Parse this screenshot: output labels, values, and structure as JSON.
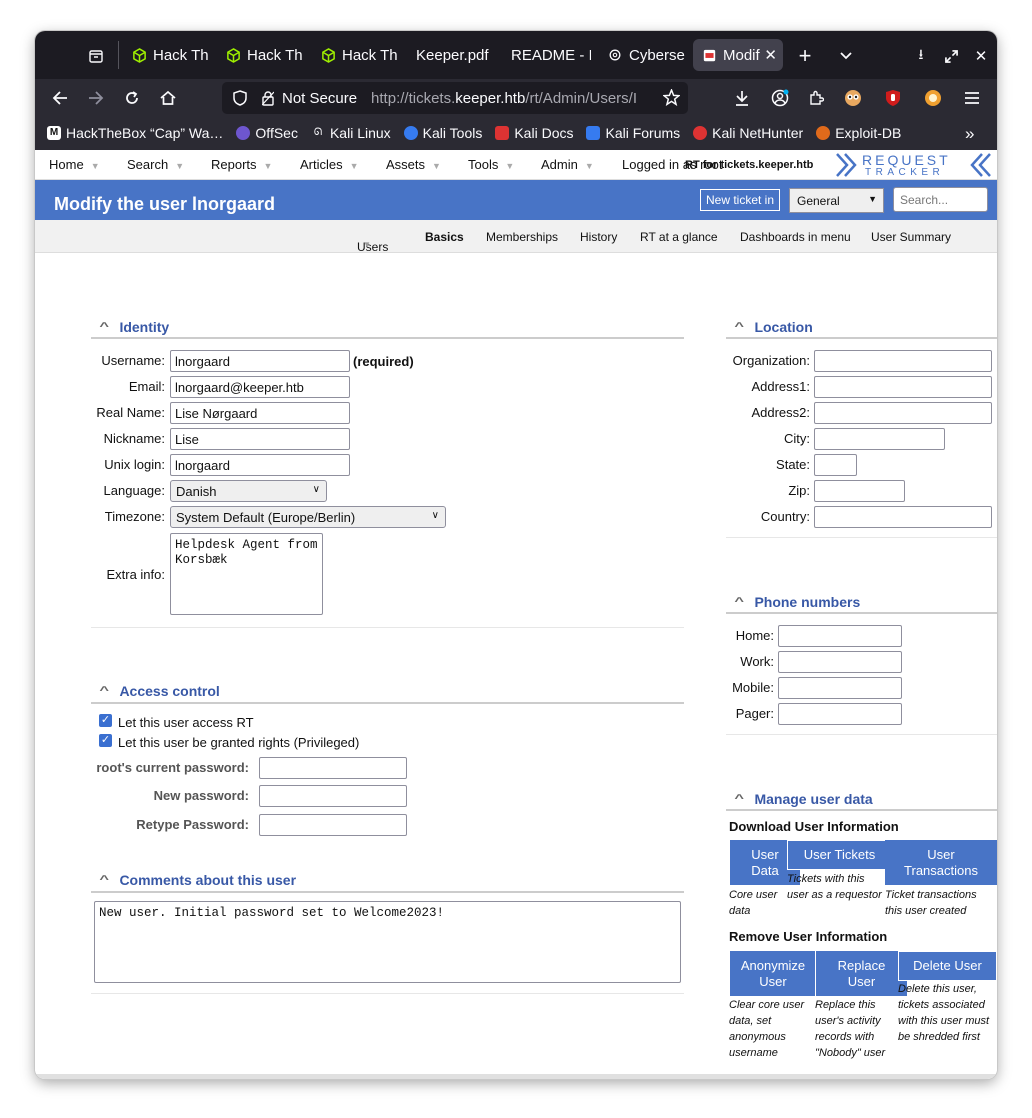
{
  "browser": {
    "tabs": [
      {
        "label": "Hack Th",
        "icon": "htb-cube-icon"
      },
      {
        "label": "Hack Th",
        "icon": "htb-cube-icon"
      },
      {
        "label": "Hack Th",
        "icon": "htb-cube-icon"
      },
      {
        "label": "Keeper.pdf",
        "icon": ""
      },
      {
        "label": "README - I",
        "icon": ""
      },
      {
        "label": "Cyberse",
        "icon": "openai-icon"
      },
      {
        "label": "Modif",
        "icon": "rt-favicon"
      }
    ],
    "url": {
      "security": "Not Secure",
      "prefix": "http://tickets.",
      "domain": "keeper.htb",
      "path": "/rt/Admin/Users/I"
    },
    "bookmarks": [
      {
        "label": "HackTheBox “Cap” Wa…",
        "color": "#111111"
      },
      {
        "label": "OffSec",
        "color": "#6e56cf"
      },
      {
        "label": "Kali Linux",
        "color": "#2b2a33"
      },
      {
        "label": "Kali Tools",
        "color": "#367bf0"
      },
      {
        "label": "Kali Docs",
        "color": "#d33"
      },
      {
        "label": "Kali Forums",
        "color": "#367bf0"
      },
      {
        "label": "Kali NetHunter",
        "color": "#d33"
      },
      {
        "label": "Exploit-DB",
        "color": "#e06a1b"
      }
    ]
  },
  "rt": {
    "menu": [
      "Home",
      "Search",
      "Reports",
      "Articles",
      "Assets",
      "Tools",
      "Admin"
    ],
    "logged_in": "Logged in as",
    "logged_user": "root",
    "rt_for": "RT for tickets.keeper.htb",
    "logo_top": "REQUEST",
    "logo_bottom": "TRACKER",
    "title": "Modify the user lnorgaard",
    "new_ticket_btn": "New ticket in",
    "queue_value": "General",
    "search_placeholder": "Search...",
    "subnav": [
      "Users",
      "Basics",
      "Memberships",
      "History",
      "RT at a glance",
      "Dashboards in menu",
      "User Summary"
    ]
  },
  "identity": {
    "title": "Identity",
    "username_label": "Username:",
    "username": "lnorgaard",
    "required": "(required)",
    "email_label": "Email:",
    "email": "lnorgaard@keeper.htb",
    "realname_label": "Real Name:",
    "realname": "Lise Nørgaard",
    "nickname_label": "Nickname:",
    "nickname": "Lise",
    "unix_label": "Unix login:",
    "unix": "lnorgaard",
    "language_label": "Language:",
    "language": "Danish",
    "timezone_label": "Timezone:",
    "timezone": "System Default (Europe/Berlin)",
    "extra_label": "Extra info:",
    "extra": "Helpdesk Agent from\nKorsbæk"
  },
  "access": {
    "title": "Access control",
    "let_access": "Let this user access RT",
    "let_priv": "Let this user be granted rights (Privileged)",
    "current_pw_label": "root's current password:",
    "new_pw_label": "New password:",
    "retype_pw_label": "Retype Password:"
  },
  "comments": {
    "title": "Comments about this user",
    "text": "New user. Initial password set to Welcome2023!"
  },
  "location": {
    "title": "Location",
    "organization": "Organization:",
    "address1": "Address1:",
    "address2": "Address2:",
    "city": "City:",
    "state": "State:",
    "zip": "Zip:",
    "country": "Country:"
  },
  "phones": {
    "title": "Phone numbers",
    "home": "Home:",
    "work": "Work:",
    "mobile": "Mobile:",
    "pager": "Pager:"
  },
  "manage": {
    "title": "Manage user data",
    "download_heading": "Download User Information",
    "user_data_btn": "User Data",
    "user_data_hint": "Core user data",
    "user_tickets_btn": "User Tickets",
    "user_tickets_hint": "Tickets with this user as a requestor",
    "user_tx_btn": "User Transactions",
    "user_tx_hint": "Ticket transactions this user created",
    "remove_heading": "Remove User Information",
    "anon_btn": "Anonymize User",
    "anon_hint": "Clear core user data, set anonymous username",
    "replace_btn": "Replace User",
    "replace_hint": "Replace this user's activity records with \"Nobody\" user",
    "delete_btn": "Delete User",
    "delete_hint": "Delete this user, tickets associated with this user must be shredded first"
  },
  "colors": {
    "header": "#4874c6",
    "title_blue": "#3858a6",
    "browser_dark": "#1c1b22"
  }
}
